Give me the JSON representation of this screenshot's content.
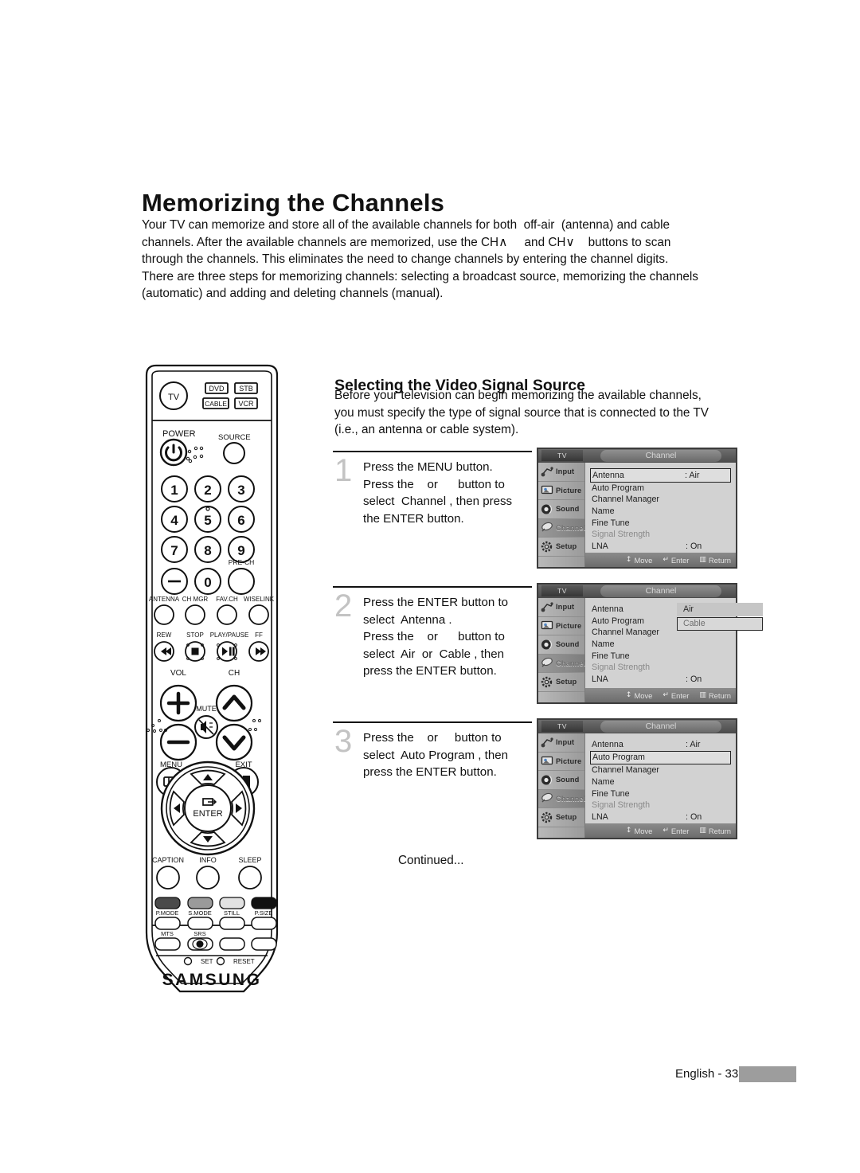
{
  "page": {
    "title": "Memorizing the Channels",
    "intro_lines": [
      "Your TV can memorize and store all of the available channels for both  off-air  (antenna) and cable",
      "channels. After the available channels are memorized, use the CH∧     and CH∨    buttons to scan",
      "through the channels. This eliminates the need to change channels by entering the channel digits.",
      "There are three steps for memorizing channels: selecting a broadcast source, memorizing the channels",
      "(automatic) and adding and deleting channels (manual)."
    ],
    "footer_text": "English - 33"
  },
  "section": {
    "title": "Selecting the Video Signal Source",
    "intro_lines": [
      "Before your television can begin memorizing the available channels,",
      "you must specify the type of signal source that is connected to the TV",
      "(i.e., an antenna or cable system)."
    ],
    "continued": "Continued..."
  },
  "steps": [
    {
      "number": "1",
      "lines": [
        "Press the MENU button.",
        "Press the    or      button to",
        "select  Channel , then press",
        "the ENTER button."
      ]
    },
    {
      "number": "2",
      "lines": [
        "Press the ENTER button to",
        "select  Antenna .",
        "Press the    or      button to",
        "select  Air  or  Cable , then",
        "press the ENTER button."
      ]
    },
    {
      "number": "3",
      "lines": [
        "Press the    or     button to",
        "select  Auto Program , then",
        "press the ENTER button."
      ]
    }
  ],
  "osd": {
    "source_label": "TV",
    "tab_label": "Channel",
    "sidebar": [
      {
        "label": "Input",
        "icon": "input-icon",
        "selected": false
      },
      {
        "label": "Picture",
        "icon": "picture-icon",
        "selected": false
      },
      {
        "label": "Sound",
        "icon": "sound-icon",
        "selected": false
      },
      {
        "label": "Channel",
        "icon": "channel-icon",
        "selected": true
      },
      {
        "label": "Setup",
        "icon": "setup-icon",
        "selected": false
      }
    ],
    "footer": [
      {
        "glyph": "↕",
        "label": "Move"
      },
      {
        "glyph": "↵",
        "label": "Enter"
      },
      {
        "glyph": "▥",
        "label": "Return"
      }
    ],
    "rows": [
      {
        "key": "Antenna",
        "value": ": Air"
      },
      {
        "key": "Auto Program",
        "value": ""
      },
      {
        "key": "Channel Manager",
        "value": ""
      },
      {
        "key": "Name",
        "value": ""
      },
      {
        "key": "Fine Tune",
        "value": ""
      },
      {
        "key": "Signal Strength",
        "value": ""
      },
      {
        "key": "LNA",
        "value": ": On"
      }
    ],
    "screen1": {
      "highlight_index": 0
    },
    "screen2": {
      "highlight_index": -1,
      "popup_options": [
        {
          "label": "Air",
          "selected": false
        },
        {
          "label": "Cable",
          "selected": true
        }
      ]
    },
    "screen3": {
      "highlight_index": 1
    }
  },
  "remote": {
    "brand": "SAMSUNG",
    "mode_buttons": [
      "TV",
      "DVD",
      "STB",
      "CABLE",
      "VCR"
    ],
    "power_label": "POWER",
    "source_label": "SOURCE",
    "keypad": [
      "1",
      "2",
      "3",
      "4",
      "5",
      "6",
      "7",
      "8",
      "9",
      "–",
      "0",
      ""
    ],
    "pre_ch_label": "PRE-CH",
    "function_row": [
      "ANTENNA",
      "CH MGR",
      "FAV.CH",
      "WISELINK"
    ],
    "transport_row": [
      "REW",
      "STOP",
      "PLAY/PAUSE",
      "FF"
    ],
    "vol_label": "VOL",
    "ch_label": "CH",
    "mute_label": "MUTE",
    "menu_label": "MENU",
    "exit_label": "EXIT",
    "enter_label": "ENTER",
    "bottom_row": [
      "CAPTION",
      "INFO",
      "SLEEP"
    ],
    "color_row": [
      "P.MODE",
      "S.MODE",
      "STILL",
      "P.SIZE"
    ],
    "audio_row": [
      "MTS",
      "SRS"
    ],
    "set_label": "SET",
    "reset_label": "RESET",
    "colors": [
      "#4a4a4a",
      "#9a9a9a",
      "#e2e2e2",
      "#111111"
    ]
  }
}
